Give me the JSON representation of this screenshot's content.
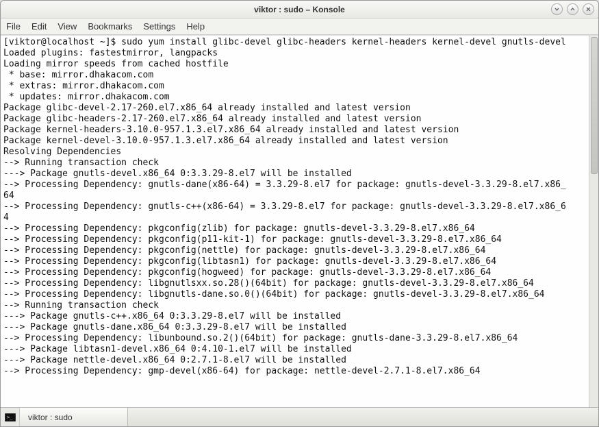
{
  "window": {
    "title": "viktor : sudo – Konsole"
  },
  "menu": {
    "file": "File",
    "edit": "Edit",
    "view": "View",
    "bookmarks": "Bookmarks",
    "settings": "Settings",
    "help": "Help"
  },
  "terminal": {
    "lines": [
      "[viktor@localhost ~]$ sudo yum install glibc-devel glibc-headers kernel-headers kernel-devel gnutls-devel",
      "Loaded plugins: fastestmirror, langpacks",
      "Loading mirror speeds from cached hostfile",
      " * base: mirror.dhakacom.com",
      " * extras: mirror.dhakacom.com",
      " * updates: mirror.dhakacom.com",
      "Package glibc-devel-2.17-260.el7.x86_64 already installed and latest version",
      "Package glibc-headers-2.17-260.el7.x86_64 already installed and latest version",
      "Package kernel-headers-3.10.0-957.1.3.el7.x86_64 already installed and latest version",
      "Package kernel-devel-3.10.0-957.1.3.el7.x86_64 already installed and latest version",
      "Resolving Dependencies",
      "--> Running transaction check",
      "---> Package gnutls-devel.x86_64 0:3.3.29-8.el7 will be installed",
      "--> Processing Dependency: gnutls-dane(x86-64) = 3.3.29-8.el7 for package: gnutls-devel-3.3.29-8.el7.x86_",
      "64",
      "--> Processing Dependency: gnutls-c++(x86-64) = 3.3.29-8.el7 for package: gnutls-devel-3.3.29-8.el7.x86_6",
      "4",
      "--> Processing Dependency: pkgconfig(zlib) for package: gnutls-devel-3.3.29-8.el7.x86_64",
      "--> Processing Dependency: pkgconfig(p11-kit-1) for package: gnutls-devel-3.3.29-8.el7.x86_64",
      "--> Processing Dependency: pkgconfig(nettle) for package: gnutls-devel-3.3.29-8.el7.x86_64",
      "--> Processing Dependency: pkgconfig(libtasn1) for package: gnutls-devel-3.3.29-8.el7.x86_64",
      "--> Processing Dependency: pkgconfig(hogweed) for package: gnutls-devel-3.3.29-8.el7.x86_64",
      "--> Processing Dependency: libgnutlsxx.so.28()(64bit) for package: gnutls-devel-3.3.29-8.el7.x86_64",
      "--> Processing Dependency: libgnutls-dane.so.0()(64bit) for package: gnutls-devel-3.3.29-8.el7.x86_64",
      "--> Running transaction check",
      "---> Package gnutls-c++.x86_64 0:3.3.29-8.el7 will be installed",
      "---> Package gnutls-dane.x86_64 0:3.3.29-8.el7 will be installed",
      "--> Processing Dependency: libunbound.so.2()(64bit) for package: gnutls-dane-3.3.29-8.el7.x86_64",
      "---> Package libtasn1-devel.x86_64 0:4.10-1.el7 will be installed",
      "---> Package nettle-devel.x86_64 0:2.7.1-8.el7 will be installed",
      "--> Processing Dependency: gmp-devel(x86-64) for package: nettle-devel-2.7.1-8.el7.x86_64"
    ]
  },
  "taskbar": {
    "tab_label": "viktor : sudo"
  }
}
